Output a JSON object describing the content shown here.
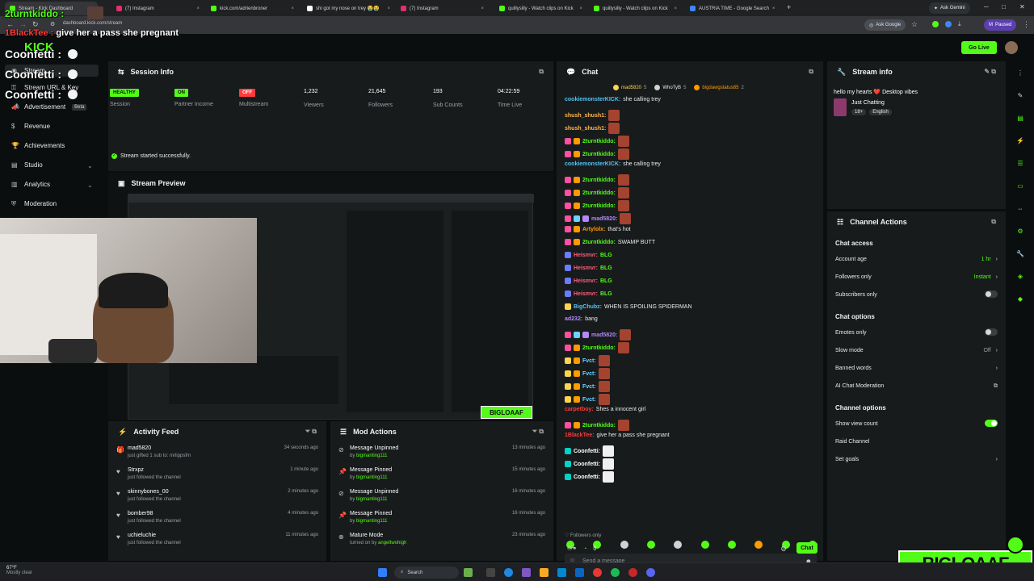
{
  "browser": {
    "tabs": [
      {
        "label": "Stream - Kick Dashboard",
        "color": "#53fc18"
      },
      {
        "label": "(7) Instagram",
        "color": "#e1306c"
      },
      {
        "label": "kick.com/adrienbroner",
        "color": "#53fc18"
      },
      {
        "label": "shi got my nose on trey 😭😭",
        "color": "#ffffff"
      },
      {
        "label": "(7) Instagram",
        "color": "#e1306c"
      },
      {
        "label": "quillysilly - Watch clips on Kick",
        "color": "#53fc18"
      },
      {
        "label": "quillysilly - Watch clips on Kick",
        "color": "#53fc18"
      },
      {
        "label": "AUSTRIA TIME - Google Search",
        "color": "#4285f4"
      }
    ],
    "new_tab": "+",
    "url": "dashboard.kick.com/stream",
    "ask_gemini": "Ask Gemini",
    "ask_google": "Ask Google",
    "paused": "Paused",
    "profile_initial": "M"
  },
  "overlay": {
    "top_user": "2turntkiddo :",
    "top_msg_user": "1BlackTee :",
    "top_msg": "give her a pass she pregnant",
    "confetti": [
      "Coonfetti :",
      "Coonfetti :",
      "Coonfetti :"
    ],
    "watermark": "BIGLOAAF"
  },
  "header": {
    "logo": "KICK",
    "go_live": "Go Live"
  },
  "sidebar": {
    "items": [
      {
        "label": "Stream",
        "icon": "stream-icon"
      },
      {
        "label": "Stream URL & Key",
        "icon": "key-icon"
      },
      {
        "label": "Advertisement",
        "icon": "megaphone-icon",
        "badge": "Beta"
      },
      {
        "label": "Revenue",
        "icon": "dollar-icon"
      },
      {
        "label": "Achievements",
        "icon": "trophy-icon"
      },
      {
        "label": "Studio",
        "icon": "studio-icon"
      },
      {
        "label": "Analytics",
        "icon": "chart-icon"
      },
      {
        "label": "Moderation",
        "icon": "shield-icon"
      }
    ]
  },
  "session": {
    "title": "Session Info",
    "stats": [
      {
        "badge": "HEALTHY",
        "badge_color": "#53fc18",
        "label": "Session"
      },
      {
        "badge": "ON",
        "badge_color": "#53fc18",
        "label": "Partner Income"
      },
      {
        "badge": "OFF",
        "badge_color": "#ff3b3b",
        "label": "Multistream"
      },
      {
        "value": "1,232",
        "label": "Viewers"
      },
      {
        "value": "21,645",
        "label": "Followers"
      },
      {
        "value": "193",
        "label": "Sub Counts"
      },
      {
        "value": "04:22:59",
        "label": "Time Live"
      }
    ],
    "status": "Stream started successfully."
  },
  "preview": {
    "title": "Stream Preview",
    "watermark": "BIGLOAAF"
  },
  "activity": {
    "title": "Activity Feed",
    "items": [
      {
        "name": "mad5820",
        "desc": "just gifted 1 sub to: mrlippsfm",
        "time": "34 seconds ago",
        "icon": "gift-icon"
      },
      {
        "name": "Strxpz",
        "desc": "just followed the channel",
        "time": "1 minute ago",
        "icon": "heart-icon"
      },
      {
        "name": "skinnybones_00",
        "desc": "just followed the channel",
        "time": "2 minutes ago",
        "icon": "heart-icon"
      },
      {
        "name": "bomber98",
        "desc": "just followed the channel",
        "time": "4 minutes ago",
        "icon": "heart-icon"
      },
      {
        "name": "uchieluchie",
        "desc": "just followed the channel",
        "time": "11 minutes ago",
        "icon": "heart-icon"
      }
    ]
  },
  "mod_actions": {
    "title": "Mod Actions",
    "items": [
      {
        "name": "Message Unpinned",
        "by": "by",
        "mod": "bigmanting111",
        "time": "13 minutes ago",
        "icon": "pin-off-icon"
      },
      {
        "name": "Message Pinned",
        "by": "by",
        "mod": "bigmanting111",
        "time": "15 minutes ago",
        "icon": "pin-icon"
      },
      {
        "name": "Message Unpinned",
        "by": "by",
        "mod": "bigmanting111",
        "time": "16 minutes ago",
        "icon": "pin-off-icon"
      },
      {
        "name": "Message Pinned",
        "by": "by",
        "mod": "bigmanting111",
        "time": "16 minutes ago",
        "icon": "pin-icon"
      },
      {
        "name": "Mature Mode",
        "by": "turned on by",
        "mod": "angeltwohigh",
        "time": "23 minutes ago",
        "icon": "mature-icon"
      }
    ]
  },
  "chat": {
    "title": "Chat",
    "gifters": [
      {
        "name": "mad5820",
        "count": "5"
      },
      {
        "name": "WhoTyB",
        "count": "5"
      },
      {
        "name": "bigdawgstatus85",
        "count": "2"
      }
    ],
    "messages": [
      {
        "user": "cookiemonsterKICK:",
        "color": "#4fc3f7",
        "text": "she calling trey",
        "badges": [],
        "emotes": 0
      },
      {
        "user": "shush_shush1:",
        "color": "#ffb74d",
        "text": "",
        "badges": [],
        "emotes": 1
      },
      {
        "user": "shush_shush1:",
        "color": "#ffb74d",
        "text": "",
        "badges": [],
        "emotes": 1
      },
      {
        "user": "2turntkiddo:",
        "color": "#53fc18",
        "text": "",
        "badges": [
          "#ff4fa0",
          "#ff9a00"
        ],
        "emotes": 1
      },
      {
        "user": "2turntkiddo:",
        "color": "#53fc18",
        "text": "",
        "badges": [
          "#ff4fa0",
          "#ff9a00"
        ],
        "emotes": 1
      },
      {
        "user": "cookiemonsterKICK:",
        "color": "#4fc3f7",
        "text": "she calling trey",
        "badges": [],
        "emotes": 0
      },
      {
        "user": "2turntkiddo:",
        "color": "#53fc18",
        "text": "",
        "badges": [
          "#ff4fa0",
          "#ff9a00"
        ],
        "emotes": 1
      },
      {
        "user": "2turntkiddo:",
        "color": "#53fc18",
        "text": "",
        "badges": [
          "#ff4fa0",
          "#ff9a00"
        ],
        "emotes": 1
      },
      {
        "user": "2turntkiddo:",
        "color": "#53fc18",
        "text": "",
        "badges": [
          "#ff4fa0",
          "#ff9a00"
        ],
        "emotes": 1
      },
      {
        "user": "mad5820:",
        "color": "#b388ff",
        "text": "",
        "badges": [
          "#ff4fa0",
          "#6bd3ff",
          "#b388ff"
        ],
        "emotes": 1
      },
      {
        "user": "Artylolx:",
        "color": "#ff9a00",
        "text": "that's hot",
        "badges": [
          "#ff4fa0",
          "#ff9a00"
        ],
        "emotes": 0
      },
      {
        "user": "2turntkiddo:",
        "color": "#53fc18",
        "text": "SWAMP BUTT",
        "badges": [
          "#ff4fa0",
          "#ff9a00"
        ],
        "emotes": 0
      },
      {
        "user": "Heismvr:",
        "color": "#ff5b7a",
        "text": "BLG",
        "badges": [
          "#6b7cff"
        ],
        "emotes": 0,
        "text_color": "#53fc18"
      },
      {
        "user": "Heismvr:",
        "color": "#ff5b7a",
        "text": "BLG",
        "badges": [
          "#6b7cff"
        ],
        "emotes": 0,
        "text_color": "#53fc18"
      },
      {
        "user": "Heismvr:",
        "color": "#ff5b7a",
        "text": "BLG",
        "badges": [
          "#6b7cff"
        ],
        "emotes": 0,
        "text_color": "#53fc18"
      },
      {
        "user": "Heismvr:",
        "color": "#ff5b7a",
        "text": "BLG",
        "badges": [
          "#6b7cff"
        ],
        "emotes": 0,
        "text_color": "#53fc18"
      },
      {
        "user": "BigChubz:",
        "color": "#4fc3f7",
        "text": "WHEN IS SPOILING SPIDERMAN",
        "badges": [
          "#ffd54f"
        ],
        "emotes": 0
      },
      {
        "user": "ad232:",
        "color": "#b388ff",
        "text": "bang",
        "badges": [],
        "emotes": 0
      },
      {
        "user": "mad5820:",
        "color": "#b388ff",
        "text": "",
        "badges": [
          "#ff4fa0",
          "#6bd3ff",
          "#b388ff"
        ],
        "emotes": 1
      },
      {
        "user": "2turntkiddo:",
        "color": "#53fc18",
        "text": "",
        "badges": [
          "#ff4fa0",
          "#ff9a00"
        ],
        "emotes": 1
      },
      {
        "user": "Fvct:",
        "color": "#6bd3ff",
        "text": "",
        "badges": [
          "#ffd54f",
          "#ff9a00"
        ],
        "emotes": 1
      },
      {
        "user": "Fvct:",
        "color": "#6bd3ff",
        "text": "",
        "badges": [
          "#ffd54f",
          "#ff9a00"
        ],
        "emotes": 1
      },
      {
        "user": "Fvct:",
        "color": "#6bd3ff",
        "text": "",
        "badges": [
          "#ffd54f",
          "#ff9a00"
        ],
        "emotes": 1
      },
      {
        "user": "Fvct:",
        "color": "#6bd3ff",
        "text": "",
        "badges": [
          "#ffd54f",
          "#ff9a00"
        ],
        "emotes": 1
      },
      {
        "user": "carpetboy:",
        "color": "#ff3b3b",
        "text": "Shes a innocent girl",
        "badges": [],
        "emotes": 0
      },
      {
        "user": "2turntkiddo:",
        "color": "#53fc18",
        "text": "",
        "badges": [
          "#ff4fa0",
          "#ff9a00"
        ],
        "emotes": 1
      },
      {
        "user": "1BlackTee:",
        "color": "#ff3b3b",
        "text": "give her a pass she pregnant",
        "badges": [],
        "emotes": 0
      },
      {
        "user": "Coonfetti:",
        "color": "#ffffff",
        "text": "",
        "badges": [
          "#00d4c8"
        ],
        "emotes": 1,
        "emote_color": "#f0f0f0"
      },
      {
        "user": "Coonfetti:",
        "color": "#ffffff",
        "text": "",
        "badges": [
          "#00d4c8"
        ],
        "emotes": 1,
        "emote_color": "#f0f0f0"
      },
      {
        "user": "Coonfetti:",
        "color": "#ffffff",
        "text": "",
        "badges": [
          "#00d4c8"
        ],
        "emotes": 1,
        "emote_color": "#f0f0f0"
      }
    ],
    "followers_only": "Followers only",
    "input_placeholder": "Send a message",
    "points": "0",
    "send": "Chat"
  },
  "stream_info": {
    "title": "Stream info",
    "stream_title": "hello my hearts ❤️ Desktop vibes",
    "category": "Just Chatting",
    "tags": [
      "18+",
      "English"
    ]
  },
  "channel_actions": {
    "title": "Channel Actions",
    "sections": [
      {
        "header": "Chat access",
        "options": [
          {
            "label": "Account age",
            "value": "1 hr",
            "value_color": "#53fc18",
            "kind": "chevron"
          },
          {
            "label": "Followers only",
            "value": "Instant",
            "value_color": "#53fc18",
            "kind": "chevron"
          },
          {
            "label": "Subscribers only",
            "kind": "toggle",
            "on": false
          }
        ]
      },
      {
        "header": "Chat options",
        "options": [
          {
            "label": "Emotes only",
            "kind": "toggle",
            "on": false
          },
          {
            "label": "Slow mode",
            "value": "Off",
            "value_color": "#9aa0a6",
            "kind": "chevron"
          },
          {
            "label": "Banned words",
            "kind": "chevron"
          },
          {
            "label": "AI Chat Moderation",
            "kind": "external"
          }
        ]
      },
      {
        "header": "Channel options",
        "options": [
          {
            "label": "Show view count",
            "kind": "toggle",
            "on": true
          },
          {
            "label": "Raid Channel",
            "kind": "none"
          },
          {
            "label": "Set goals",
            "kind": "chevron"
          }
        ]
      }
    ]
  },
  "taskbar": {
    "weather_temp": "67°F",
    "weather_desc": "Mostly clear",
    "search": "Search"
  },
  "colors": {
    "accent": "#53fc18",
    "panel": "#181b1c",
    "bg": "#0b0e0f"
  }
}
